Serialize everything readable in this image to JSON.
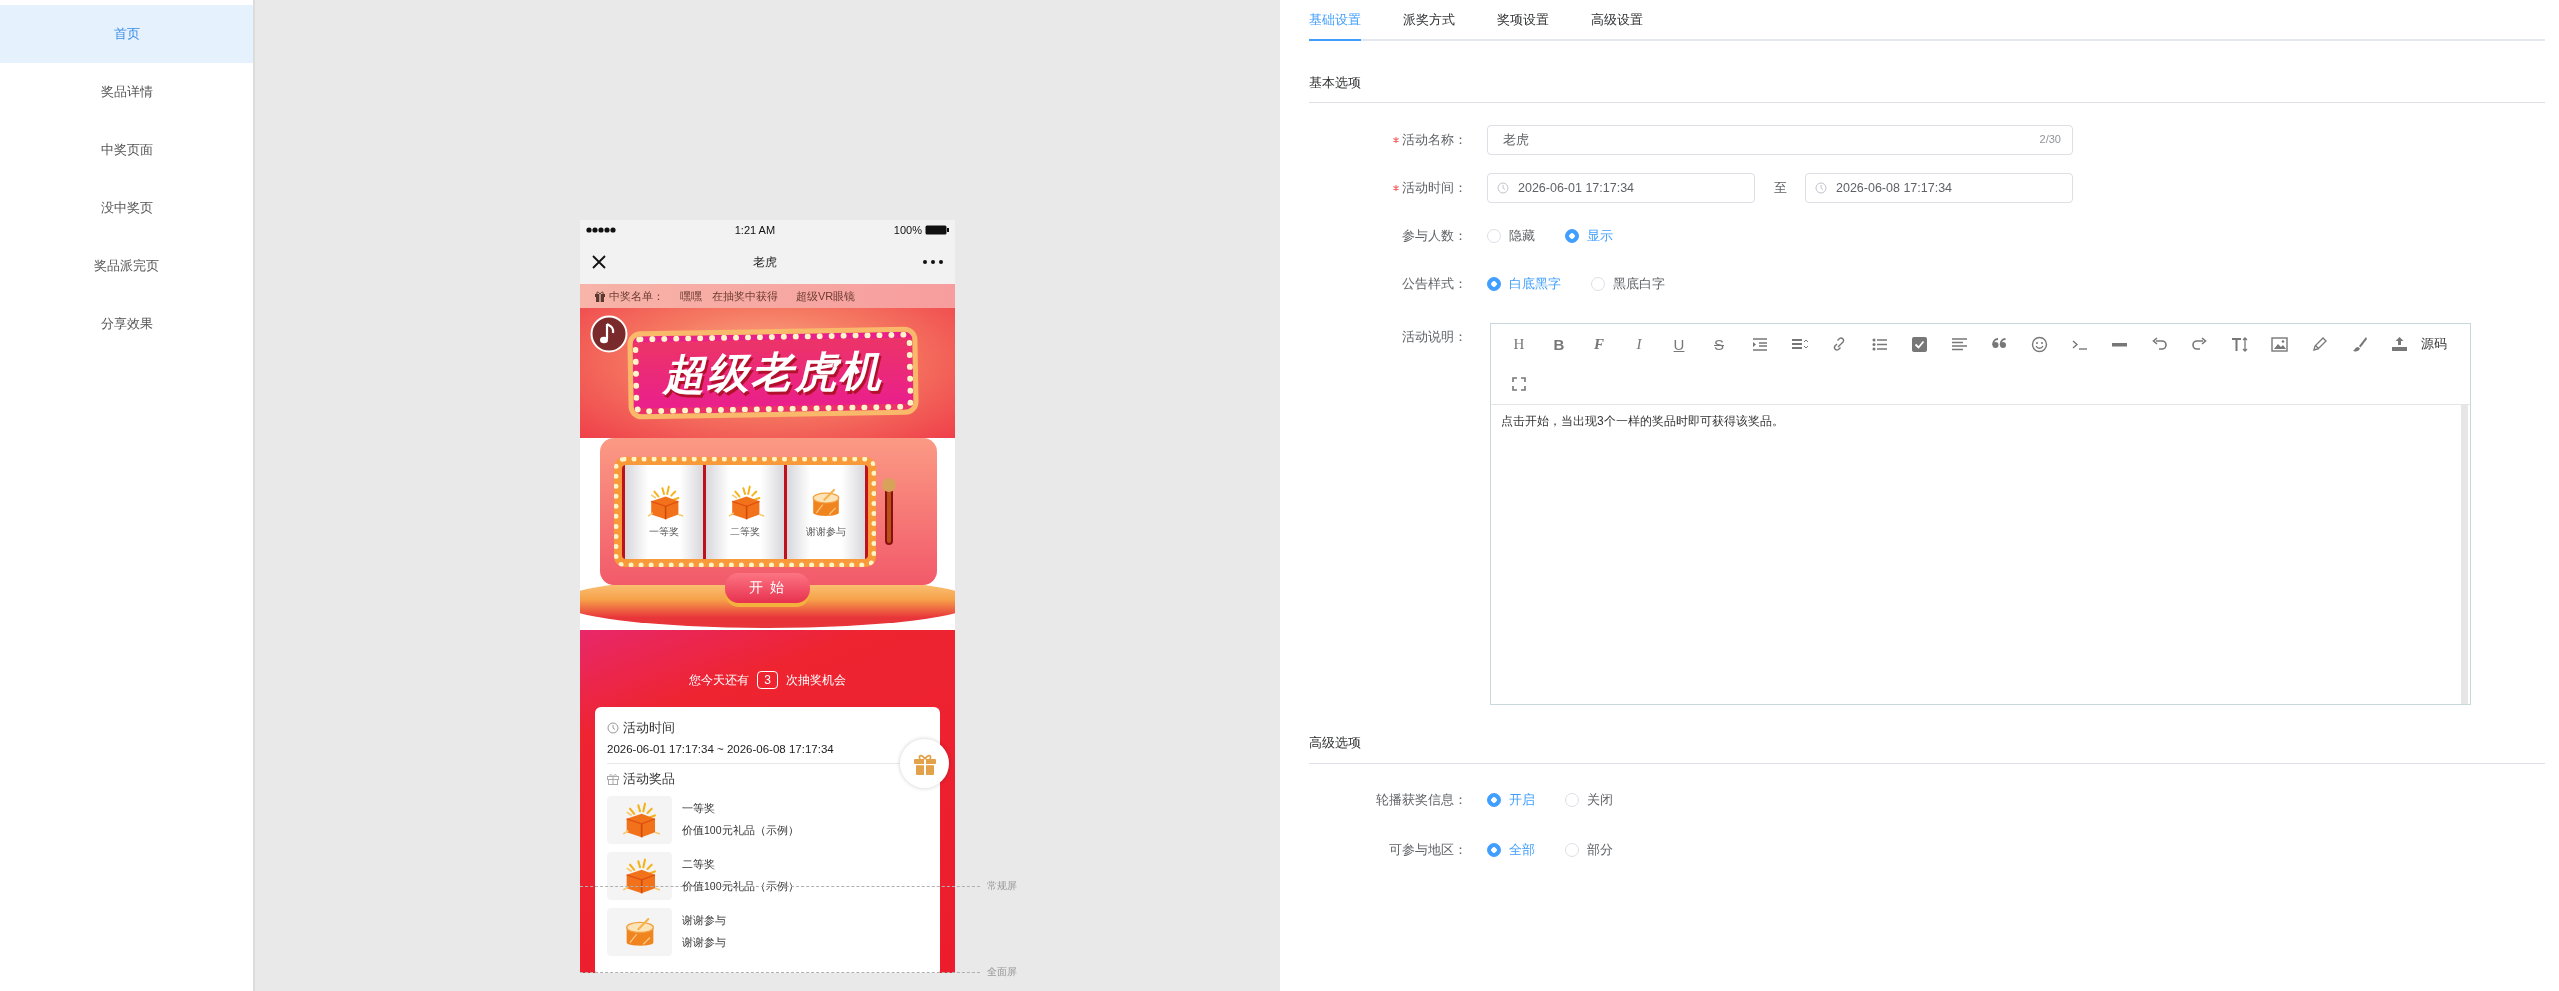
{
  "sidebar": {
    "items": [
      {
        "label": "首页",
        "selected": true
      },
      {
        "label": "奖品详情",
        "selected": false
      },
      {
        "label": "中奖页面",
        "selected": false
      },
      {
        "label": "没中奖页",
        "selected": false
      },
      {
        "label": "奖品派完页",
        "selected": false
      },
      {
        "label": "分享效果",
        "selected": false
      }
    ]
  },
  "preview": {
    "status_bar": {
      "time": "1:21 AM",
      "battery": "100%"
    },
    "nav_bar": {
      "title": "老虎"
    },
    "ticker": {
      "label": "中奖名单：",
      "entries": [
        "嘿嘿",
        "在抽奖中获得",
        "超级VR眼镜"
      ]
    },
    "banner": {
      "title": "超级老虎机"
    },
    "reels": [
      {
        "label": "一等奖",
        "kind": "gift"
      },
      {
        "label": "二等奖",
        "kind": "gift"
      },
      {
        "label": "谢谢参与",
        "kind": "drum"
      }
    ],
    "start_button": "开 始",
    "chances": {
      "before": "您今天还有",
      "count": "3",
      "after": "次抽奖机会"
    },
    "info": {
      "time_heading": "活动时间",
      "time_range": "2026-06-01 17:17:34 ~ 2026-06-08 17:17:34",
      "prizes_heading": "活动奖品",
      "prizes": [
        {
          "name": "一等奖",
          "desc": "价值100元礼品（示例）",
          "kind": "gift"
        },
        {
          "name": "二等奖",
          "desc": "价值100元礼品（示例）",
          "kind": "gift"
        },
        {
          "name": "谢谢参与",
          "desc": "谢谢参与",
          "kind": "drum"
        }
      ]
    },
    "guides": [
      {
        "label": "常规屏"
      },
      {
        "label": "全面屏"
      }
    ]
  },
  "settings": {
    "tabs": [
      {
        "label": "基础设置",
        "selected": true
      },
      {
        "label": "派奖方式",
        "selected": false
      },
      {
        "label": "奖项设置",
        "selected": false
      },
      {
        "label": "高级设置",
        "selected": false
      }
    ],
    "basic": {
      "heading": "基本选项",
      "name_field": {
        "label": "活动名称：",
        "required": true,
        "value": "老虎",
        "counter": "2/30"
      },
      "time_field": {
        "label": "活动时间：",
        "required": true,
        "start": "2026-06-01 17:17:34",
        "separator": "至",
        "end": "2026-06-08 17:17:34"
      },
      "radio_rows": [
        {
          "label": "参与人数：",
          "options": [
            {
              "label": "隐藏",
              "selected": false
            },
            {
              "label": "显示",
              "selected": true
            }
          ]
        },
        {
          "label": "公告样式：",
          "options": [
            {
              "label": "白底黑字",
              "selected": true
            },
            {
              "label": "黑底白字",
              "selected": false
            }
          ]
        }
      ],
      "description": {
        "label": "活动说明：",
        "toolbar": {
          "letters": [
            "H",
            "B",
            "F",
            "I",
            "U",
            "S"
          ],
          "source_button": "源码"
        },
        "content": "点击开始，当出现3个一样的奖品时即可获得该奖品。"
      }
    },
    "advanced": {
      "heading": "高级选项",
      "radio_rows": [
        {
          "label": "轮播获奖信息：",
          "options": [
            {
              "label": "开启",
              "selected": true
            },
            {
              "label": "关闭",
              "selected": false
            }
          ]
        },
        {
          "label": "可参与地区：",
          "options": [
            {
              "label": "全部",
              "selected": true
            },
            {
              "label": "部分",
              "selected": false
            }
          ]
        }
      ]
    }
  }
}
